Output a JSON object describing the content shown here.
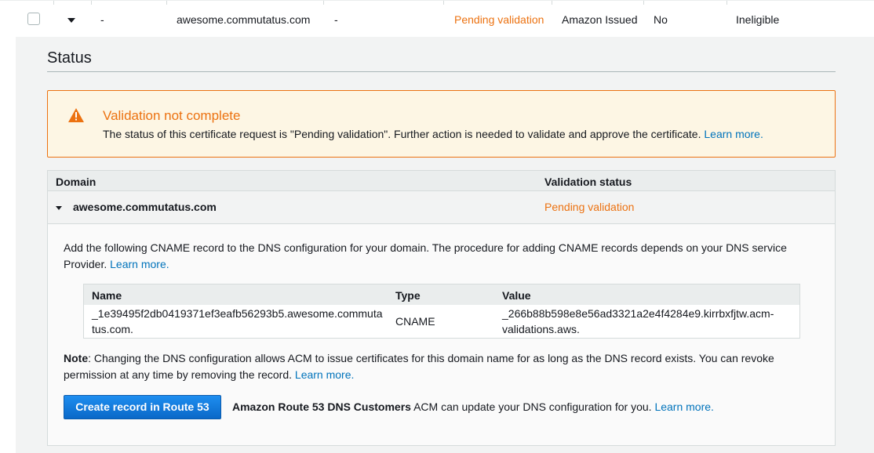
{
  "row": {
    "col1": "-",
    "domain": "awesome.commutatus.com",
    "col3": "-",
    "status": "Pending validation",
    "type": "Amazon Issued",
    "in_use": "No",
    "renewal": "Ineligible"
  },
  "status_section": {
    "title": "Status"
  },
  "alert": {
    "title": "Validation not complete",
    "text": "The status of this certificate request is \"Pending validation\". Further action is needed to validate and approve the certificate.",
    "link": "Learn more."
  },
  "validation_table": {
    "headers": {
      "domain": "Domain",
      "status": "Validation status"
    },
    "row": {
      "domain": "awesome.commutatus.com",
      "status": "Pending validation"
    }
  },
  "instructions": {
    "text": "Add the following CNAME record to the DNS configuration for your domain. The procedure for adding CNAME records depends on your DNS service Provider.",
    "link": "Learn more."
  },
  "cname_table": {
    "headers": {
      "name": "Name",
      "type": "Type",
      "value": "Value"
    },
    "name_line1": "_1e39495f2db0419371ef3eafb56293b5.awesome.commuta",
    "name_line2": "tus.com.",
    "type": "CNAME",
    "value_line1": "_266b88b598e8e56ad3321a2e4f4284e9.kirrbxfjtw.acm-",
    "value_line2": "validations.aws."
  },
  "note": {
    "label": "Note",
    "text": ": Changing the DNS configuration allows ACM to issue certificates for this domain name for as long as the DNS record exists. You can revoke permission at any time by removing the record.",
    "link": "Learn more."
  },
  "route53": {
    "button": "Create record in Route 53",
    "bold": "Amazon Route 53 DNS Customers",
    "text": "ACM can update your DNS configuration for you.",
    "link": "Learn more."
  },
  "colors": {
    "accent": "#0073bb",
    "warning": "#ec7211"
  }
}
